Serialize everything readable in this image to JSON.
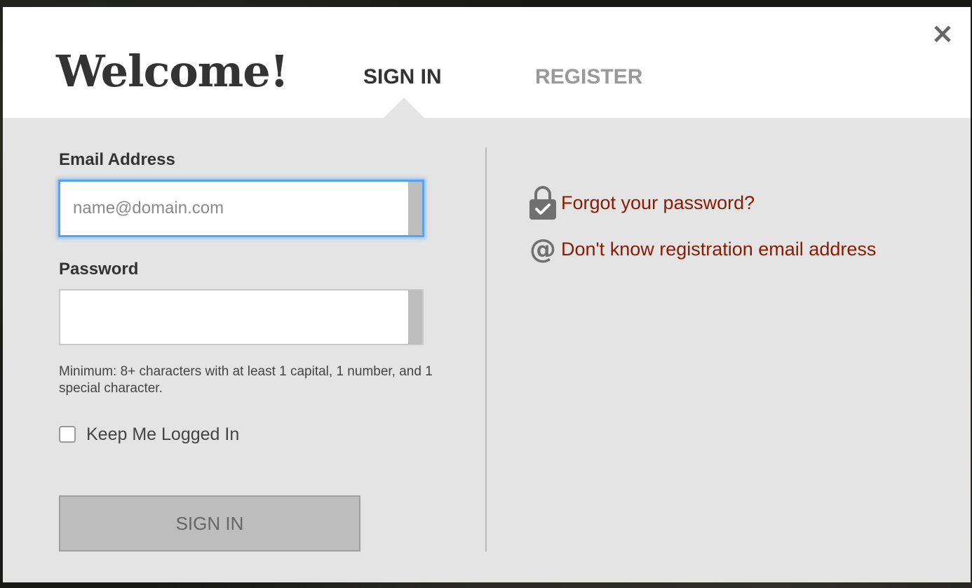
{
  "modal": {
    "title": "Welcome!",
    "close_symbol": "×",
    "tabs": [
      {
        "label": "SIGN IN",
        "active": true
      },
      {
        "label": "REGISTER",
        "active": false
      }
    ]
  },
  "form": {
    "email": {
      "label": "Email Address",
      "placeholder": "name@domain.com",
      "value": ""
    },
    "password": {
      "label": "Password",
      "value": ""
    },
    "hint": "Minimum: 8+ characters with at least 1 capital, 1 number, and 1 special character.",
    "remember": {
      "label": "Keep Me Logged In",
      "checked": false
    },
    "submit_label": "SIGN IN"
  },
  "help": {
    "forgot_password": {
      "label": "Forgot your password?",
      "icon": "lock-check-icon"
    },
    "unknown_email": {
      "label": "Don't know registration email address",
      "icon": "at-sign-icon",
      "glyph": "@"
    }
  },
  "colors": {
    "link": "#8b1a00",
    "focus_ring": "#5aa2ec",
    "panel_bg": "#e4e4e4"
  }
}
